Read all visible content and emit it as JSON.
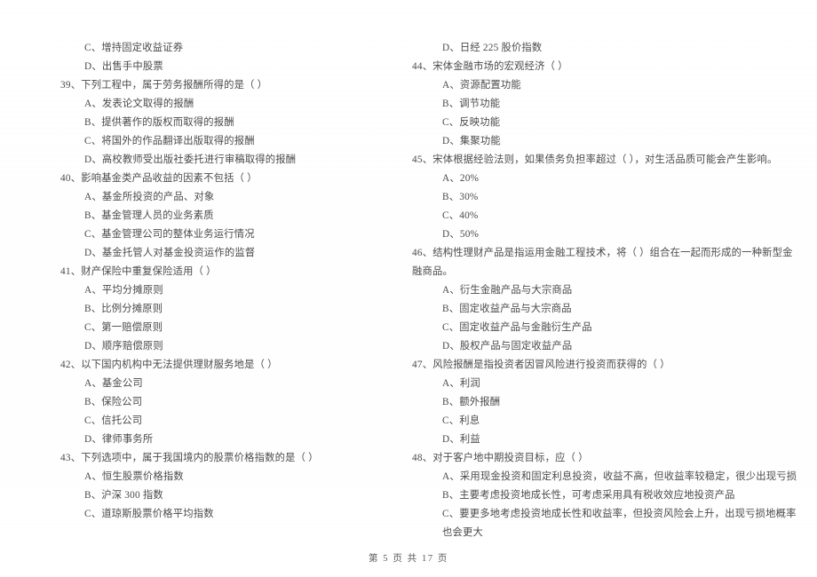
{
  "document": {
    "kind": "exam-paper-scan",
    "footer": "第 5 页  共 17 页"
  },
  "left_column": [
    {
      "type": "orphan_options",
      "options": [
        "C、增持固定收益证券",
        "D、出售手中股票"
      ]
    },
    {
      "type": "question",
      "number": "39、",
      "stem": "39、下列工程中，属于劳务报酬所得的是（        ）",
      "options": [
        "A、发表论文取得的报酬",
        "B、提供著作的版权而取得的报酬",
        "C、将国外的作品翻译出版取得的报酬",
        "D、高校教师受出版社委托进行审稿取得的报酬"
      ]
    },
    {
      "type": "question",
      "number": "40、",
      "stem": "40、影响基金类产品收益的因素不包括（        ）",
      "options": [
        "A、基金所投资的产品、对象",
        "B、基金管理人员的业务素质",
        "C、基金管理公司的整体业务运行情况",
        "D、基金托管人对基金投资运作的监督"
      ]
    },
    {
      "type": "question",
      "number": "41、",
      "stem": "41、财产保险中重复保险适用（        ）",
      "options": [
        "A、平均分摊原则",
        "B、比例分摊原则",
        "C、第一赔偿原则",
        "D、顺序赔偿原则"
      ]
    },
    {
      "type": "question",
      "number": "42、",
      "stem": "42、以下国内机构中无法提供理财服务地是（        ）",
      "options": [
        "A、基金公司",
        "B、保险公司",
        "C、信托公司",
        "D、律师事务所"
      ]
    },
    {
      "type": "question",
      "number": "43、",
      "stem": "43、下列选项中，属于我国境内的股票价格指数的是（        ）",
      "options": [
        "A、恒生股票价格指数",
        "B、沪深 300 指数",
        "C、道琼斯股票价格平均指数"
      ]
    }
  ],
  "right_column": [
    {
      "type": "orphan_options",
      "options": [
        "D、日经 225 股价指数"
      ]
    },
    {
      "type": "question",
      "number": "44、",
      "stem": "44、宋体金融市场的宏观经济（        ）",
      "options": [
        "A、资源配置功能",
        "B、调节功能",
        "C、反映功能",
        "D、集聚功能"
      ]
    },
    {
      "type": "question",
      "number": "45、",
      "stem": "45、宋体根据经验法则，如果债务负担率超过（        ），对生活品质可能会产生影响。",
      "options": [
        "A、20%",
        "B、30%",
        "C、40%",
        "D、50%"
      ]
    },
    {
      "type": "question",
      "number": "46、",
      "stem": "46、结构性理财产品是指运用金融工程技术，将（        ）组合在一起而形成的一种新型金融商品。",
      "options": [
        "A、衍生金融产品与大宗商品",
        "B、固定收益产品与大宗商品",
        "C、固定收益产品与金融衍生产品",
        "D、股权产品与固定收益产品"
      ]
    },
    {
      "type": "question",
      "number": "47、",
      "stem": "47、风险报酬是指投资者因冒风险进行投资而获得的（        ）",
      "options": [
        "A、利润",
        "B、额外报酬",
        "C、利息",
        "D、利益"
      ]
    },
    {
      "type": "question",
      "number": "48、",
      "stem": "48、对于客户地中期投资目标，应（        ）",
      "options": [
        "A、采用现金投资和固定利息投资，收益不高，但收益率较稳定，很少出现亏损",
        "B、主要考虑投资地成长性，可考虑采用具有税收效应地投资产品",
        "C、要更多地考虑投资地成长性和收益率，但投资风险会上升，出现亏损地概率也会更大"
      ]
    }
  ]
}
